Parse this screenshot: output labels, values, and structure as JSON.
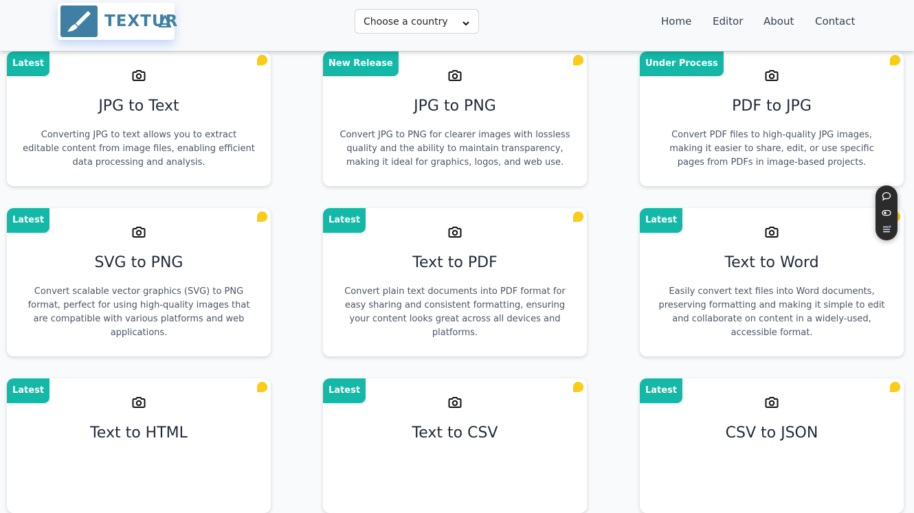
{
  "header": {
    "logo_text": "TEXTUR",
    "country_select": {
      "value": "Choose a country"
    },
    "nav": [
      "Home",
      "Editor",
      "About",
      "Contact"
    ]
  },
  "cards": [
    {
      "badge": "Latest",
      "title": "JPG to Text",
      "description": "Converting JPG to text allows you to extract editable content from image files, enabling efficient data processing and analysis."
    },
    {
      "badge": "New Release",
      "title": "JPG to PNG",
      "description": "Convert JPG to PNG for clearer images with lossless quality and the ability to maintain transparency, making it ideal for graphics, logos, and web use."
    },
    {
      "badge": "Under Process",
      "title": "PDF to JPG",
      "description": "Convert PDF files to high-quality JPG images, making it easier to share, edit, or use specific pages from PDFs in image-based projects."
    },
    {
      "badge": "Latest",
      "title": "SVG to PNG",
      "description": "Convert scalable vector graphics (SVG) to PNG format, perfect for using high-quality images that are compatible with various platforms and web applications."
    },
    {
      "badge": "Latest",
      "title": "Text to PDF",
      "description": "Convert plain text documents into PDF format for easy sharing and consistent formatting, ensuring your content looks great across all devices and platforms."
    },
    {
      "badge": "Latest",
      "title": "Text to Word",
      "description": "Easily convert text files into Word documents, preserving formatting and making it simple to edit and collaborate on content in a widely-used, accessible format."
    },
    {
      "badge": "Latest",
      "title": "Text to HTML",
      "description": ""
    },
    {
      "badge": "Latest",
      "title": "Text to CSV",
      "description": ""
    },
    {
      "badge": "Latest",
      "title": "CSV to JSON",
      "description": ""
    }
  ],
  "icons": {
    "card_icon": "camera-icon",
    "corner_marker": "chat-bubble-icon",
    "widget": [
      "chat-icon",
      "toggle-icon",
      "list-icon"
    ]
  },
  "colors": {
    "badge": "#14b8a6",
    "corner_marker": "#facc15",
    "logo": "#3f7fa3"
  }
}
